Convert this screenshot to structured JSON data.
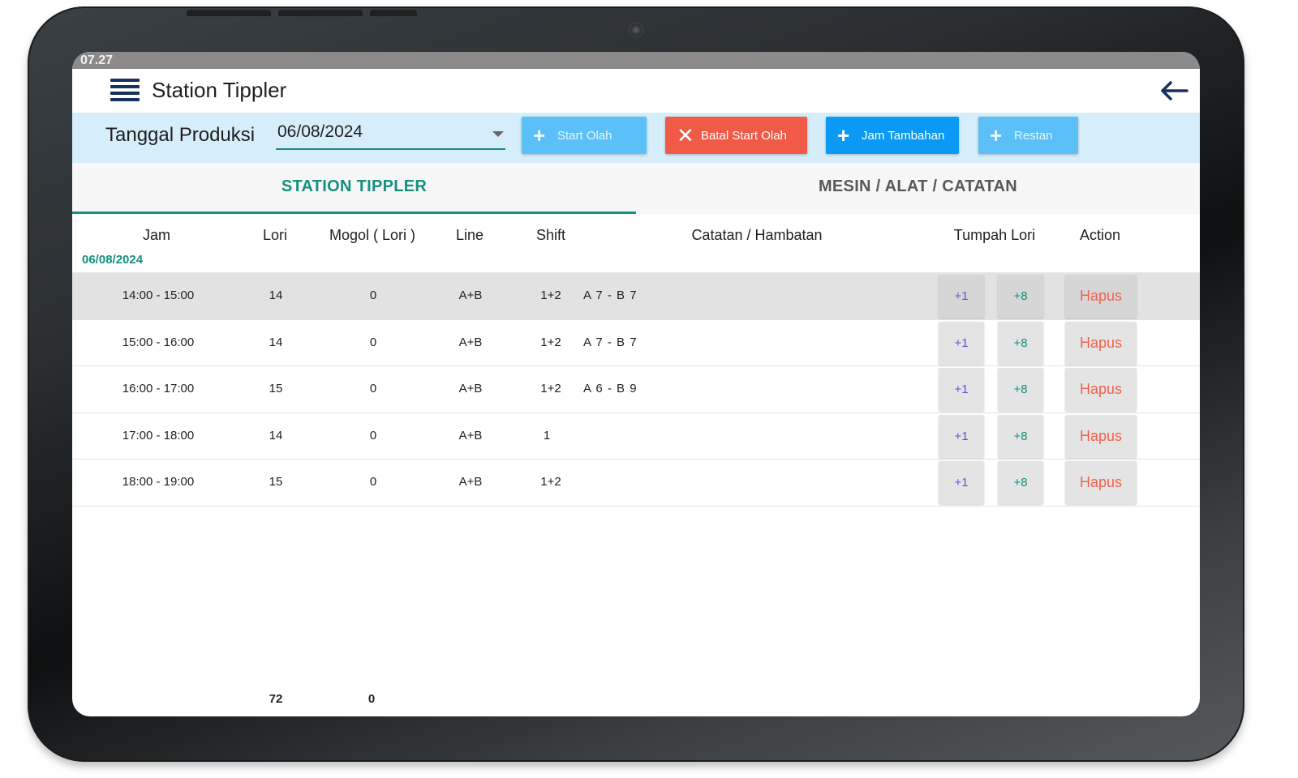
{
  "status_bar": {
    "time": "07.27"
  },
  "app_bar": {
    "title": "Station Tippler"
  },
  "filter": {
    "label": "Tanggal Produksi",
    "date_value": "06/08/2024"
  },
  "buttons": {
    "start_olah": "Start Olah",
    "batal_start_olah": "Batal Start Olah",
    "jam_tambahan": "Jam Tambahan",
    "restan": "Restan"
  },
  "tabs": [
    {
      "label": "STATION TIPPLER",
      "active": true
    },
    {
      "label": "MESIN / ALAT / CATATAN",
      "active": false
    }
  ],
  "table": {
    "headers": [
      "Jam",
      "Lori",
      "Mogol ( Lori )",
      "Line",
      "Shift",
      "Catatan / Hambatan",
      "Tumpah Lori",
      "Action"
    ],
    "group_date": "06/08/2024",
    "rows": [
      {
        "jam": "14:00 - 15:00",
        "lori": "14",
        "mogol": "0",
        "line": "A+B",
        "shift": "1+2",
        "catatan": "A 7 - B 7",
        "plus1": "+1",
        "plus8": "+8",
        "action": "Hapus",
        "selected": true
      },
      {
        "jam": "15:00 - 16:00",
        "lori": "14",
        "mogol": "0",
        "line": "A+B",
        "shift": "1+2",
        "catatan": "A 7 - B 7",
        "plus1": "+1",
        "plus8": "+8",
        "action": "Hapus",
        "selected": false
      },
      {
        "jam": "16:00 - 17:00",
        "lori": "15",
        "mogol": "0",
        "line": "A+B",
        "shift": "1+2",
        "catatan": "A 6 - B 9",
        "plus1": "+1",
        "plus8": "+8",
        "action": "Hapus",
        "selected": false
      },
      {
        "jam": "17:00 - 18:00",
        "lori": "14",
        "mogol": "0",
        "line": "A+B",
        "shift": "1",
        "catatan": "",
        "plus1": "+1",
        "plus8": "+8",
        "action": "Hapus",
        "selected": false
      },
      {
        "jam": "18:00 - 19:00",
        "lori": "15",
        "mogol": "0",
        "line": "A+B",
        "shift": "1+2",
        "catatan": "",
        "plus1": "+1",
        "plus8": "+8",
        "action": "Hapus",
        "selected": false
      }
    ],
    "totals": {
      "lori": "72",
      "mogol": "0"
    }
  },
  "colors": {
    "accent": "#15907f",
    "filter_bg": "#d5eefa",
    "btn_light_blue": "#5bc0f7",
    "btn_red": "#f25a48",
    "btn_blue": "#0a9af5",
    "hapus_text": "#f0624e"
  },
  "icons": {
    "menu": "hamburger-menu-icon",
    "back": "arrow-left-icon",
    "dropdown": "caret-down-icon",
    "plus": "plus-icon",
    "close": "close-icon"
  }
}
